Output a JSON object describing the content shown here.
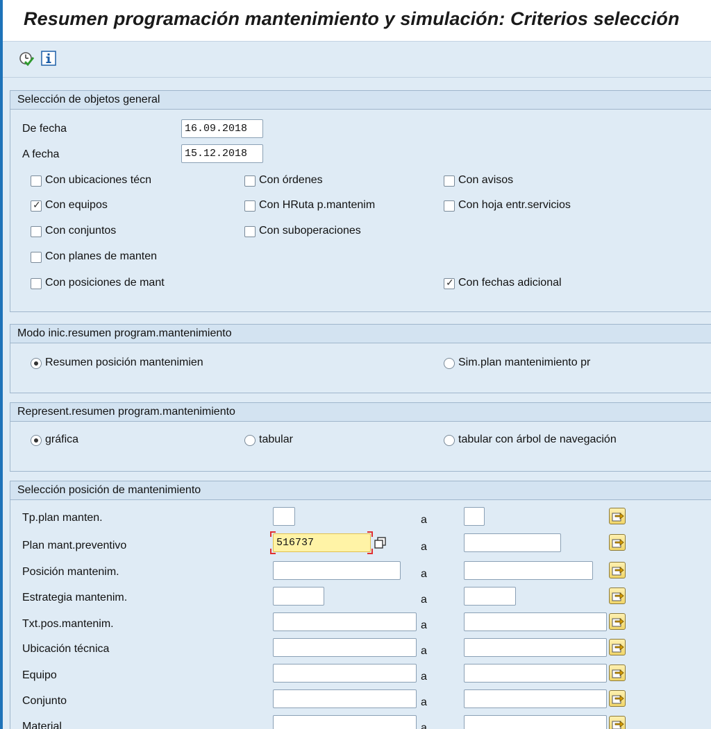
{
  "title": "Resumen programación mantenimiento y simulación: Criterios selección",
  "toolbar": {
    "execute_icon": "execute-clock-check-icon",
    "info_icon": "info-icon"
  },
  "group1": {
    "header": "Selección de objetos general",
    "from_date_label": "De fecha",
    "from_date_value": "16.09.2018",
    "to_date_label": "A fecha",
    "to_date_value": "15.12.2018",
    "checkboxes": [
      {
        "label": "Con ubicaciones técn",
        "checked": false
      },
      {
        "label": "Con órdenes",
        "checked": false
      },
      {
        "label": "Con avisos",
        "checked": false
      },
      {
        "label": "Con equipos",
        "checked": true
      },
      {
        "label": "Con HRuta p.mantenim",
        "checked": false
      },
      {
        "label": "Con hoja entr.servicios",
        "checked": false
      },
      {
        "label": "Con conjuntos",
        "checked": false
      },
      {
        "label": "Con suboperaciones",
        "checked": false
      },
      {
        "label": "Con planes de manten",
        "checked": false
      },
      {
        "label": "Con posiciones de mant",
        "checked": false
      },
      {
        "label": "Con fechas adicional",
        "checked": true
      }
    ]
  },
  "group2": {
    "header": "Modo inic.resumen program.mantenimiento",
    "options": [
      {
        "label": "Resumen posición mantenimien",
        "selected": true
      },
      {
        "label": "Sim.plan mantenimiento pr",
        "selected": false
      }
    ]
  },
  "group3": {
    "header": "Represent.resumen program.mantenimiento",
    "options": [
      {
        "label": "gráfica",
        "selected": true
      },
      {
        "label": "tabular",
        "selected": false
      },
      {
        "label": "tabular con árbol de navegación",
        "selected": false
      }
    ]
  },
  "group4": {
    "header": "Selección posición de mantenimiento",
    "to_label": "a",
    "rows": [
      {
        "label": "Tp.plan manten.",
        "from": "",
        "to": ""
      },
      {
        "label": "Plan mant.preventivo",
        "from": "516737",
        "to": ""
      },
      {
        "label": "Posición mantenim.",
        "from": "",
        "to": ""
      },
      {
        "label": "Estrategia mantenim.",
        "from": "",
        "to": ""
      },
      {
        "label": "Txt.pos.mantenim.",
        "from": "",
        "to": ""
      },
      {
        "label": "Ubicación técnica",
        "from": "",
        "to": ""
      },
      {
        "label": "Equipo",
        "from": "",
        "to": ""
      },
      {
        "label": "Conjunto",
        "from": "",
        "to": ""
      },
      {
        "label": "Material",
        "from": "",
        "to": ""
      }
    ]
  },
  "colors": {
    "accent": "#1e73b9",
    "background": "#dfebf5",
    "group_header": "#d3e3f1",
    "focus_field": "#fff3a6"
  }
}
